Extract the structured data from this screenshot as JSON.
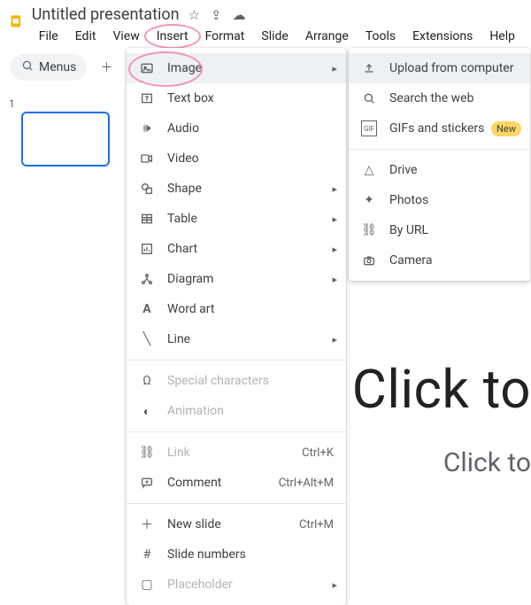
{
  "header": {
    "doc_title": "Untitled presentation",
    "menus": {
      "file": "File",
      "edit": "Edit",
      "view": "View",
      "insert": "Insert",
      "format": "Format",
      "slide": "Slide",
      "arrange": "Arrange",
      "tools": "Tools",
      "extensions": "Extensions",
      "help": "Help"
    }
  },
  "toolbar": {
    "menus_chip": "Menus"
  },
  "slide_number": "1",
  "insert_menu": {
    "image": "Image",
    "textbox": "Text box",
    "audio": "Audio",
    "video": "Video",
    "shape": "Shape",
    "table": "Table",
    "chart": "Chart",
    "diagram": "Diagram",
    "wordart": "Word art",
    "line": "Line",
    "special": "Special characters",
    "animation": "Animation",
    "link": "Link",
    "link_sc": "Ctrl+K",
    "comment": "Comment",
    "comment_sc": "Ctrl+Alt+M",
    "newslide": "New slide",
    "newslide_sc": "Ctrl+M",
    "slidenumbers": "Slide numbers",
    "placeholder": "Placeholder"
  },
  "image_submenu": {
    "upload": "Upload from computer",
    "search": "Search the web",
    "gifs": "GIFs and stickers",
    "new_badge": "New",
    "drive": "Drive",
    "photos": "Photos",
    "byurl": "By URL",
    "camera": "Camera"
  },
  "canvas": {
    "title_hint": "Click to",
    "subtitle_hint": "Click to"
  }
}
